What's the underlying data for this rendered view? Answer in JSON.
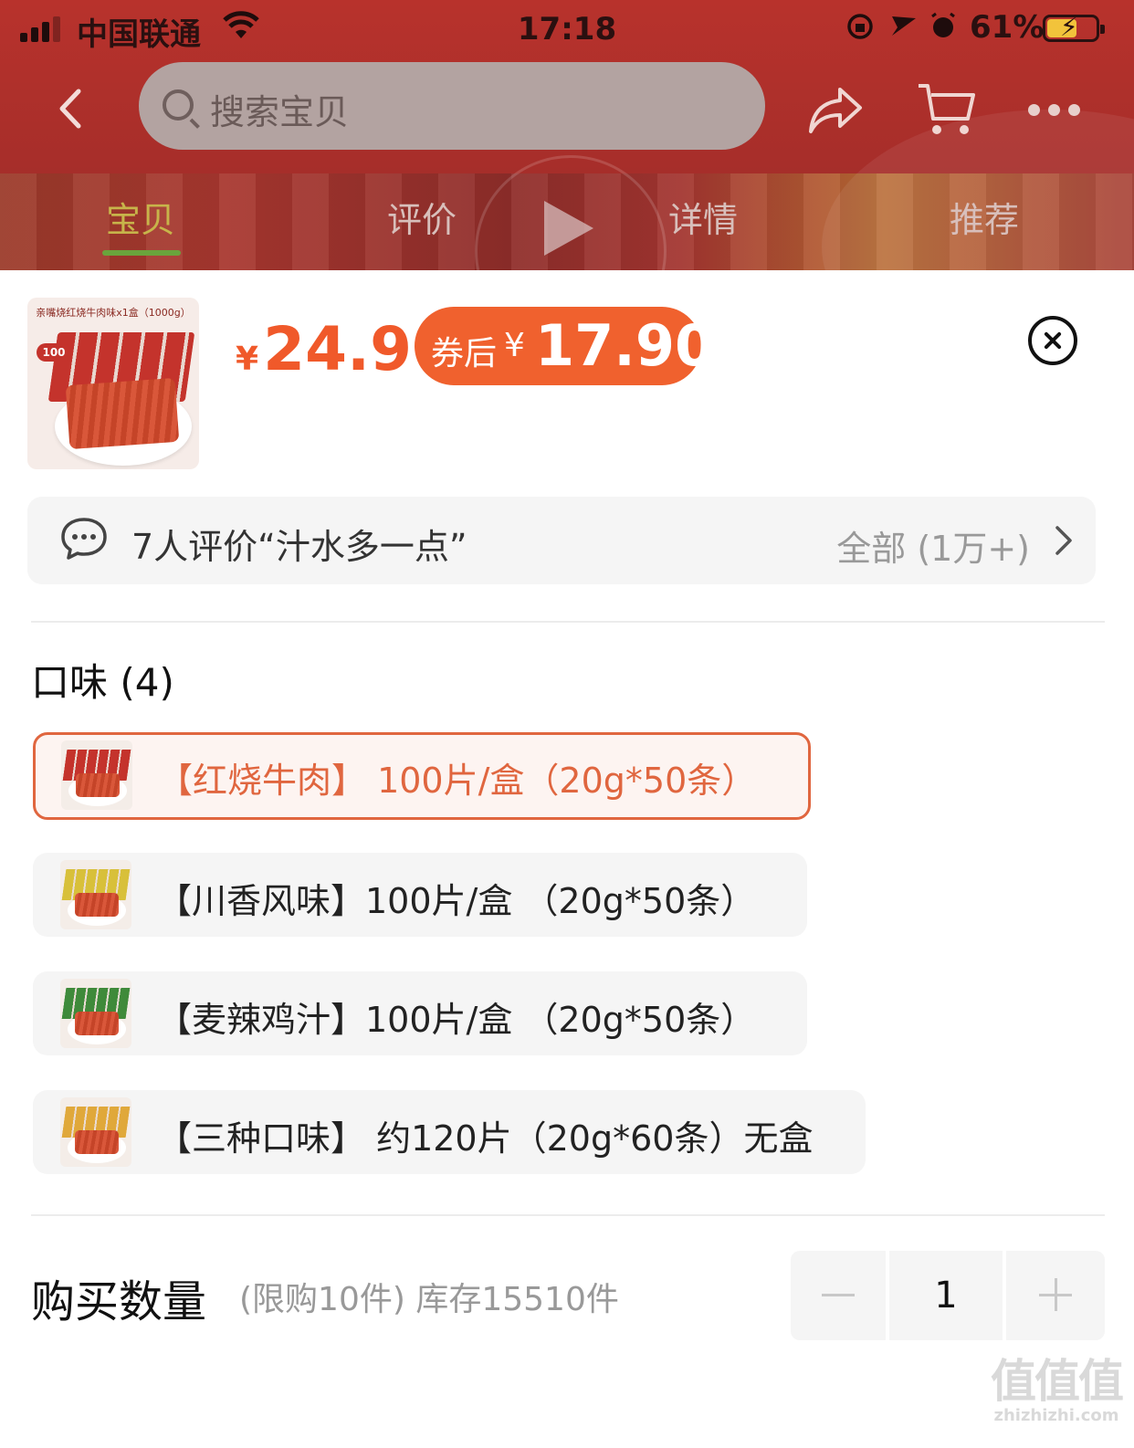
{
  "status_bar": {
    "carrier": "中国联通",
    "time": "17:18",
    "battery_percent": "61%",
    "battery_level": 0.61
  },
  "nav": {
    "search_placeholder": "搜索宝贝",
    "icons": [
      "back-icon",
      "search-icon",
      "share-icon",
      "cart-icon",
      "more-icon"
    ]
  },
  "tabs": [
    {
      "label": "宝贝",
      "active": true
    },
    {
      "label": "评价",
      "active": false
    },
    {
      "label": "详情",
      "active": false
    },
    {
      "label": "推荐",
      "active": false
    }
  ],
  "product": {
    "thumb_caption": "亲嘴烧红烧牛肉味x1盒（1000g）",
    "thumb_badge": "100",
    "price_symbol": "¥",
    "price": "24.9",
    "coupon_label": "券后",
    "coupon_symbol": "¥",
    "coupon_price": "17.90"
  },
  "review": {
    "summary": "7人评价“汁水多一点”",
    "all_label": "全部 (1万+)"
  },
  "flavor": {
    "title": "口味 (4)",
    "options": [
      {
        "label": "【红烧牛肉】 100片/盒（20g*50条）",
        "selected": true,
        "box_color": "#c4332c"
      },
      {
        "label": "【川香风味】100片/盒 （20g*50条）",
        "selected": false,
        "box_color": "#d8c03a"
      },
      {
        "label": "【麦辣鸡汁】100片/盒 （20g*50条）",
        "selected": false,
        "box_color": "#3f8a3a"
      },
      {
        "label": "【三种口味】 约120片（20g*60条）无盒",
        "selected": false,
        "box_color": "#e0a83a"
      }
    ]
  },
  "quantity": {
    "title": "购买数量",
    "note": "(限购10件) 库存15510件",
    "value": "1"
  },
  "watermark": {
    "big": "值值值",
    "small": "zhizhizhi.com"
  },
  "colors": {
    "accent": "#f0592a",
    "selected_border": "#e0663f",
    "option_bg": "#f5f5f5",
    "header_red": "#a72e2a"
  }
}
